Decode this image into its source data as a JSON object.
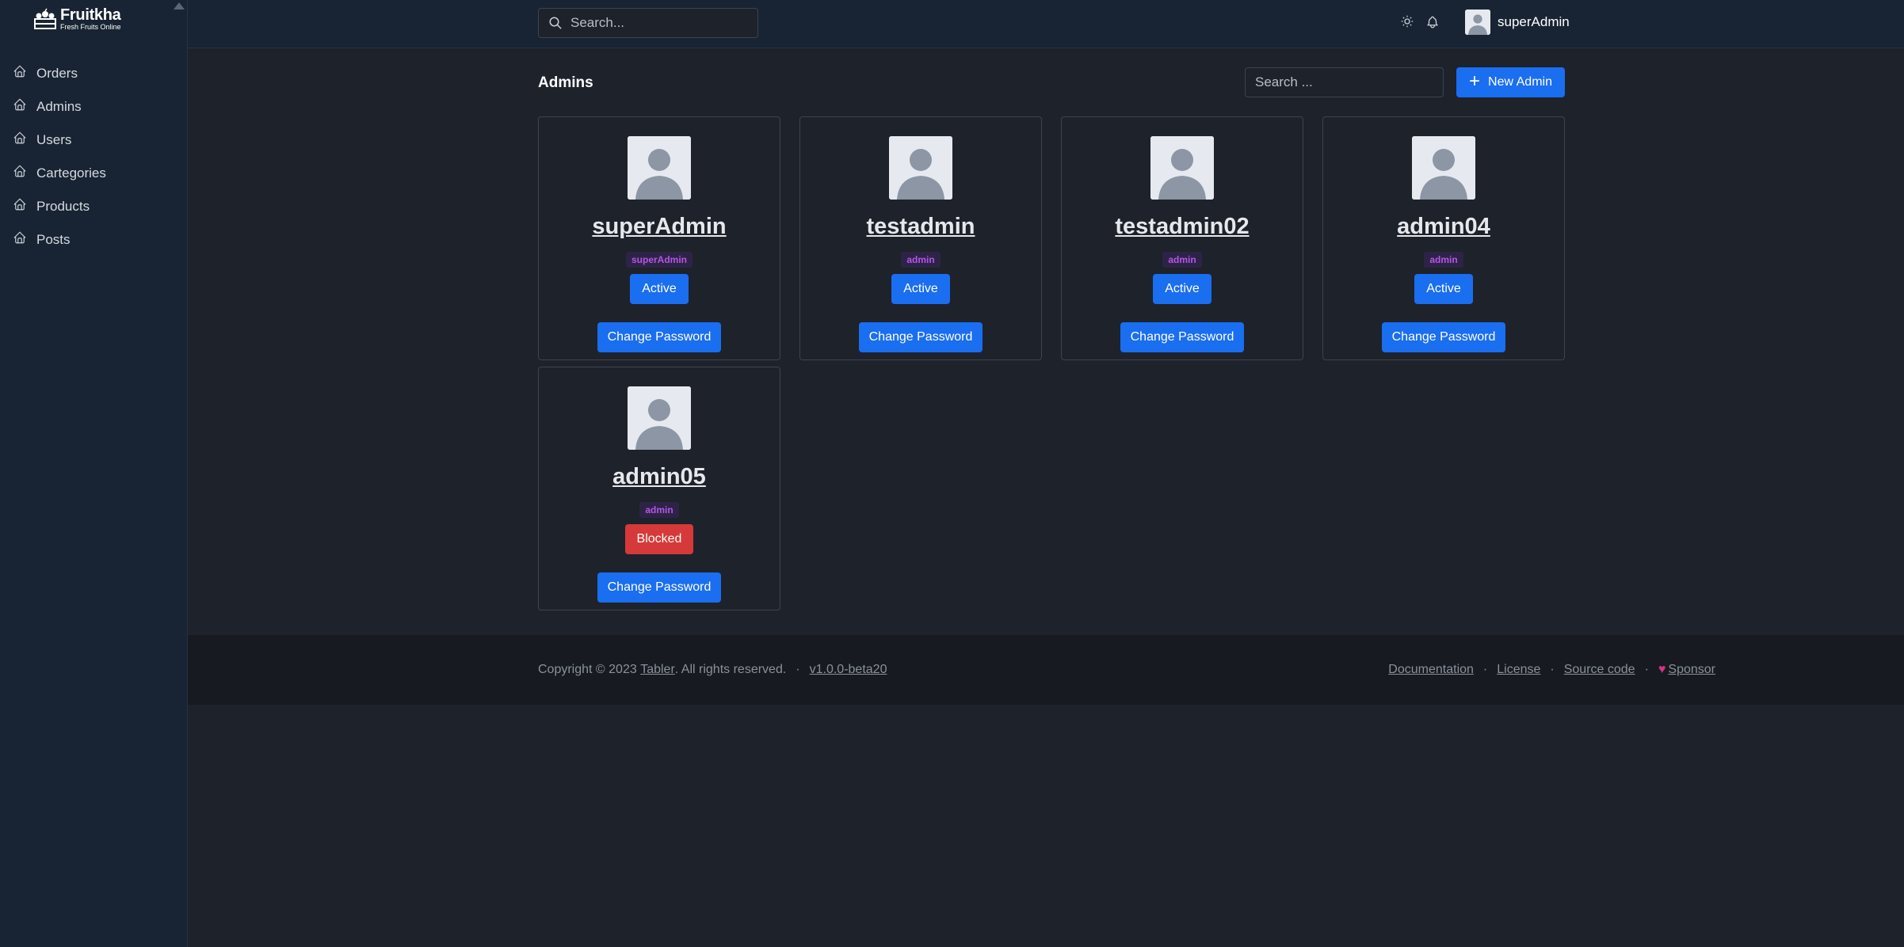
{
  "brand": {
    "name": "Fruitkha",
    "tagline": "Fresh Fruits Online"
  },
  "sidebar": {
    "items": [
      {
        "label": "Orders",
        "icon": "home-icon"
      },
      {
        "label": "Admins",
        "icon": "home-icon"
      },
      {
        "label": "Users",
        "icon": "home-icon"
      },
      {
        "label": "Cartegories",
        "icon": "home-icon"
      },
      {
        "label": "Products",
        "icon": "home-icon"
      },
      {
        "label": "Posts",
        "icon": "home-icon"
      }
    ]
  },
  "header": {
    "search_placeholder": "Search...",
    "user_name": "superAdmin",
    "icons": [
      "sun-icon",
      "bell-icon"
    ]
  },
  "main": {
    "title": "Admins",
    "search_placeholder": "Search ...",
    "new_button": "New Admin",
    "admins": [
      {
        "username": "superAdmin",
        "role": "superAdmin",
        "status": "Active",
        "status_type": "active",
        "action": "Change Password"
      },
      {
        "username": "testadmin",
        "role": "admin",
        "status": "Active",
        "status_type": "active",
        "action": "Change Password"
      },
      {
        "username": "testadmin02",
        "role": "admin",
        "status": "Active",
        "status_type": "active",
        "action": "Change Password"
      },
      {
        "username": "admin04",
        "role": "admin",
        "status": "Active",
        "status_type": "active",
        "action": "Change Password"
      },
      {
        "username": "admin05",
        "role": "admin",
        "status": "Blocked",
        "status_type": "blocked",
        "action": "Change Password"
      }
    ]
  },
  "footer": {
    "copyright_prefix": "Copyright © 2023",
    "brand_link": "Tabler",
    "copyright_suffix": ". All rights reserved.",
    "dot": "·",
    "version": "v1.0.0-beta20",
    "links": [
      "Documentation",
      "License",
      "Source code",
      "Sponsor"
    ]
  },
  "colors": {
    "primary": "#1a6ef0",
    "danger": "#d63939",
    "sidebar_bg": "#182433",
    "page_bg": "#1e222b",
    "role_text": "#b456e3"
  }
}
